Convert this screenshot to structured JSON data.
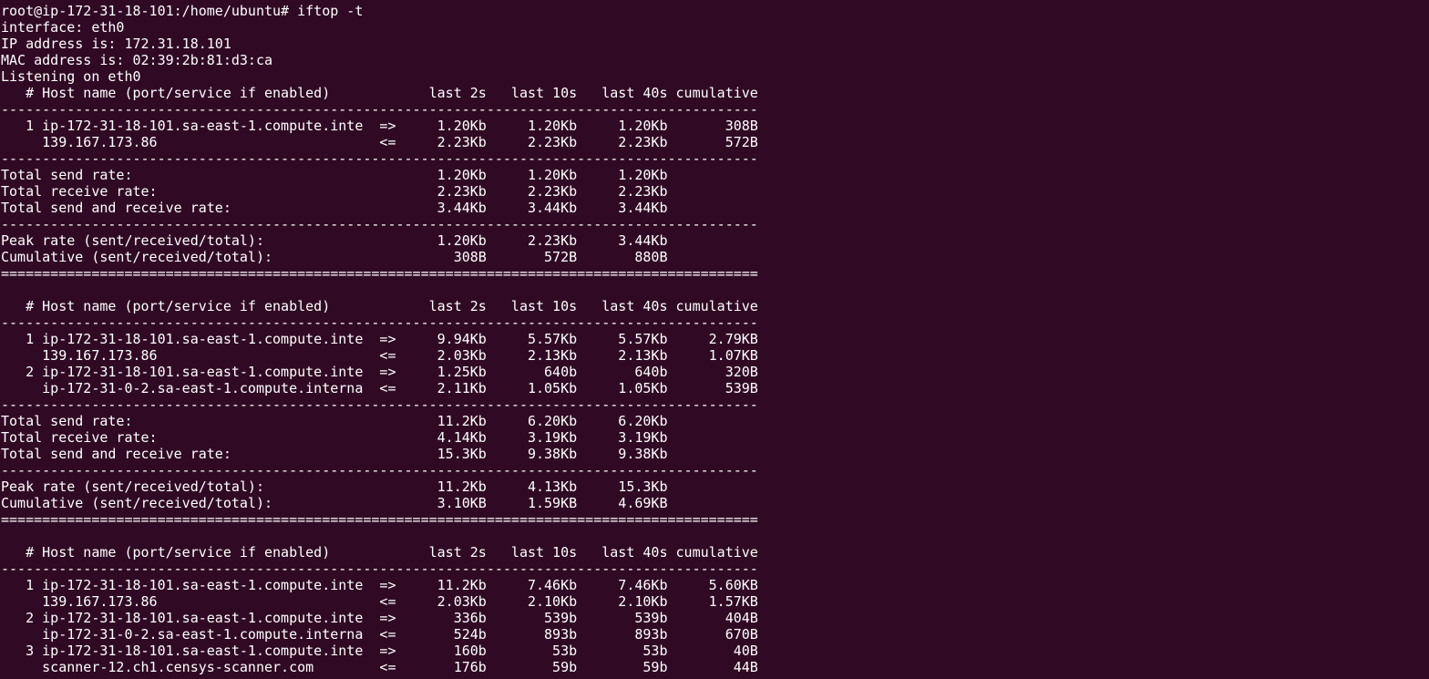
{
  "terminal": {
    "lines": [
      "root@ip-172-31-18-101:/home/ubuntu# iftop -t",
      "interface: eth0",
      "IP address is: 172.31.18.101",
      "MAC address is: 02:39:2b:81:d3:ca",
      "Listening on eth0",
      "   # Host name (port/service if enabled)            last 2s   last 10s   last 40s cumulative",
      "--------------------------------------------------------------------------------------------",
      "   1 ip-172-31-18-101.sa-east-1.compute.inte  =>     1.20Kb     1.20Kb     1.20Kb       308B",
      "     139.167.173.86                           <=     2.23Kb     2.23Kb     2.23Kb       572B",
      "--------------------------------------------------------------------------------------------",
      "Total send rate:                                     1.20Kb     1.20Kb     1.20Kb",
      "Total receive rate:                                  2.23Kb     2.23Kb     2.23Kb",
      "Total send and receive rate:                         3.44Kb     3.44Kb     3.44Kb",
      "--------------------------------------------------------------------------------------------",
      "Peak rate (sent/received/total):                     1.20Kb     2.23Kb     3.44Kb",
      "Cumulative (sent/received/total):                      308B       572B       880B",
      "============================================================================================",
      "",
      "   # Host name (port/service if enabled)            last 2s   last 10s   last 40s cumulative",
      "--------------------------------------------------------------------------------------------",
      "   1 ip-172-31-18-101.sa-east-1.compute.inte  =>     9.94Kb     5.57Kb     5.57Kb     2.79KB",
      "     139.167.173.86                           <=     2.03Kb     2.13Kb     2.13Kb     1.07KB",
      "   2 ip-172-31-18-101.sa-east-1.compute.inte  =>     1.25Kb       640b       640b       320B",
      "     ip-172-31-0-2.sa-east-1.compute.interna  <=     2.11Kb     1.05Kb     1.05Kb       539B",
      "--------------------------------------------------------------------------------------------",
      "Total send rate:                                     11.2Kb     6.20Kb     6.20Kb",
      "Total receive rate:                                  4.14Kb     3.19Kb     3.19Kb",
      "Total send and receive rate:                         15.3Kb     9.38Kb     9.38Kb",
      "--------------------------------------------------------------------------------------------",
      "Peak rate (sent/received/total):                     11.2Kb     4.13Kb     15.3Kb",
      "Cumulative (sent/received/total):                    3.10KB     1.59KB     4.69KB",
      "============================================================================================",
      "",
      "   # Host name (port/service if enabled)            last 2s   last 10s   last 40s cumulative",
      "--------------------------------------------------------------------------------------------",
      "   1 ip-172-31-18-101.sa-east-1.compute.inte  =>     11.2Kb     7.46Kb     7.46Kb     5.60KB",
      "     139.167.173.86                           <=     2.03Kb     2.10Kb     2.10Kb     1.57KB",
      "   2 ip-172-31-18-101.sa-east-1.compute.inte  =>       336b       539b       539b       404B",
      "     ip-172-31-0-2.sa-east-1.compute.interna  <=       524b       893b       893b       670B",
      "   3 ip-172-31-18-101.sa-east-1.compute.inte  =>       160b        53b        53b        40B",
      "     scanner-12.ch1.censys-scanner.com        <=       176b        59b        59b        44B"
    ]
  }
}
